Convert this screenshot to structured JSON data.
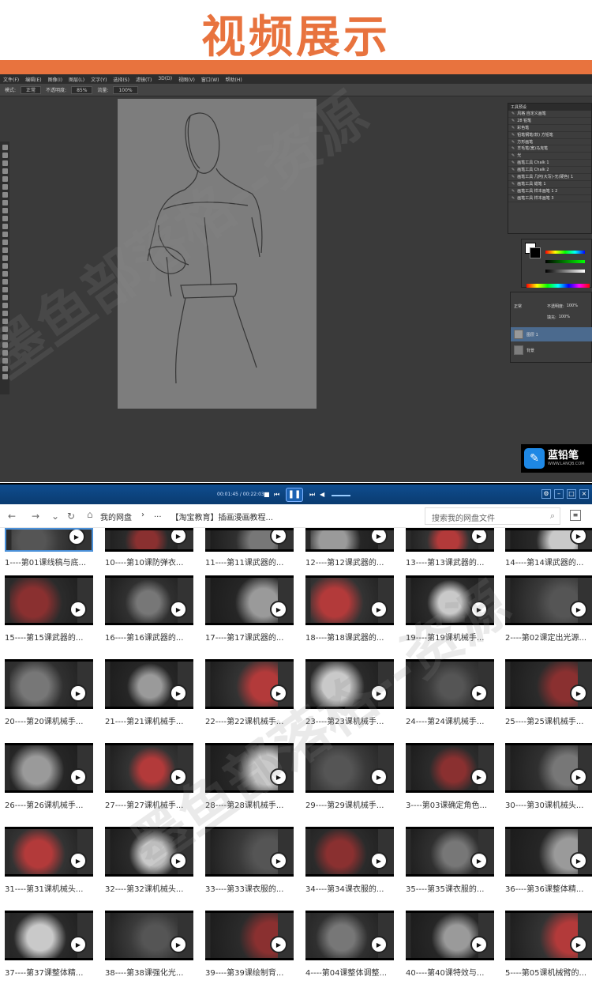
{
  "banner": {
    "title": "视频展示"
  },
  "photoshop": {
    "menu": [
      "文件(F)",
      "编辑(E)",
      "图像(I)",
      "图层(L)",
      "文字(Y)",
      "选择(S)",
      "滤镜(T)",
      "3D(D)",
      "视图(V)",
      "窗口(W)",
      "帮助(H)"
    ],
    "options": {
      "mode_label": "模式:",
      "mode_value": "正常",
      "opacity_label": "不透明度:",
      "opacity_value": "85%",
      "flow_label": "流量:",
      "flow_value": "100%"
    },
    "brush_presets_title": "工具预设",
    "brush_presets": [
      "风格 自定义画笔",
      "28 铅笔",
      "彩色笔",
      "铅笔钢笔(软) 方铅笔",
      "方形画笔",
      "羊毛笔(宽)马克笔",
      "光",
      "画笔工具 Chalk 1",
      "画笔工具 Chalk 2",
      "画笔工具 几何(大写)-无(硬色) 1",
      "画笔工具 蜡笔 1",
      "画笔工具 样本画笔 1 2",
      "画笔工具 样本画笔 3"
    ],
    "layers": {
      "mode": "正常",
      "opacity_label": "不透明度:",
      "opacity_value": "100%",
      "fill_label": "填充:",
      "fill_value": "100%",
      "items": [
        "图层 1",
        "背景"
      ]
    }
  },
  "brand": {
    "name": "蓝铅笔",
    "url": "WWW.LANQB.COM"
  },
  "player": {
    "time": "00:01:45 / 00:22:03"
  },
  "explorer": {
    "crumbs": [
      "我的网盘",
      "›",
      "...",
      "【淘宝教育】插画漫画教程..."
    ],
    "search_placeholder": "搜索我的网盘文件",
    "videos": [
      "1----第01课线稿与底...",
      "10----第10课防弹衣...",
      "11----第11课武器的...",
      "12----第12课武器的...",
      "13----第13课武器的...",
      "14----第14课武器的...",
      "15----第15课武器的...",
      "16----第16课武器的...",
      "17----第17课武器的...",
      "18----第18课武器的...",
      "19----第19课机械手...",
      "2----第02课定出光源...",
      "20----第20课机械手...",
      "21----第21课机械手...",
      "22----第22课机械手...",
      "23----第23课机械手...",
      "24----第24课机械手...",
      "25----第25课机械手...",
      "26----第26课机械手...",
      "27----第27课机械手...",
      "28----第28课机械手...",
      "29----第29课机械手...",
      "3----第03课确定角色...",
      "30----第30课机械头...",
      "31----第31课机械头...",
      "32----第32课机械头...",
      "33----第33课衣服的...",
      "34----第34课衣服的...",
      "35----第35课衣服的...",
      "36----第36课整体精...",
      "37----第37课整体精...",
      "38----第38课强化光...",
      "39----第39课绘制背...",
      "4----第04课整体调整...",
      "40----第40课特效与...",
      "5----第05课机械臂的..."
    ]
  },
  "watermark": "墨鱼部落格--资源"
}
